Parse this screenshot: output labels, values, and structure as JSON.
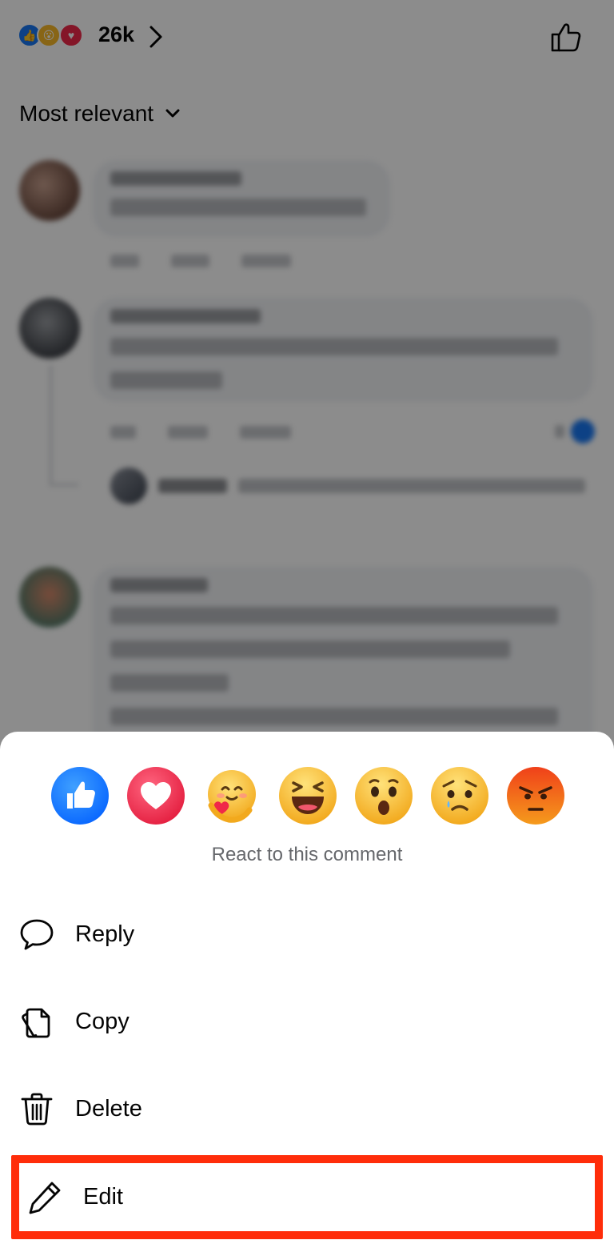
{
  "header": {
    "reaction_icons": [
      "like-icon",
      "wow-icon",
      "love-icon"
    ],
    "reaction_count": "26k",
    "chevron_icon": "chevron-right-icon",
    "like_icon": "thumbs-up-outline-icon"
  },
  "sort": {
    "label": "Most relevant",
    "icon": "chevron-down-icon"
  },
  "reaction_picker": {
    "reactions": [
      {
        "name": "like",
        "icon": "like-reaction-icon",
        "color": "#1877f2"
      },
      {
        "name": "love",
        "icon": "love-reaction-icon",
        "color": "#f02849"
      },
      {
        "name": "care",
        "icon": "care-reaction-icon",
        "color": "#f7b928"
      },
      {
        "name": "haha",
        "icon": "haha-reaction-icon",
        "color": "#f7b928"
      },
      {
        "name": "wow",
        "icon": "wow-reaction-icon",
        "color": "#f7b928"
      },
      {
        "name": "sad",
        "icon": "sad-reaction-icon",
        "color": "#f7b928"
      },
      {
        "name": "angry",
        "icon": "angry-reaction-icon",
        "color": "#e9710f"
      }
    ],
    "caption": "React to this comment"
  },
  "menu": {
    "items": [
      {
        "label": "Reply",
        "icon": "speech-bubble-icon"
      },
      {
        "label": "Copy",
        "icon": "copy-icon"
      },
      {
        "label": "Delete",
        "icon": "trash-icon"
      },
      {
        "label": "Edit",
        "icon": "pencil-icon",
        "highlight_color": "#ff2d0a"
      }
    ]
  }
}
